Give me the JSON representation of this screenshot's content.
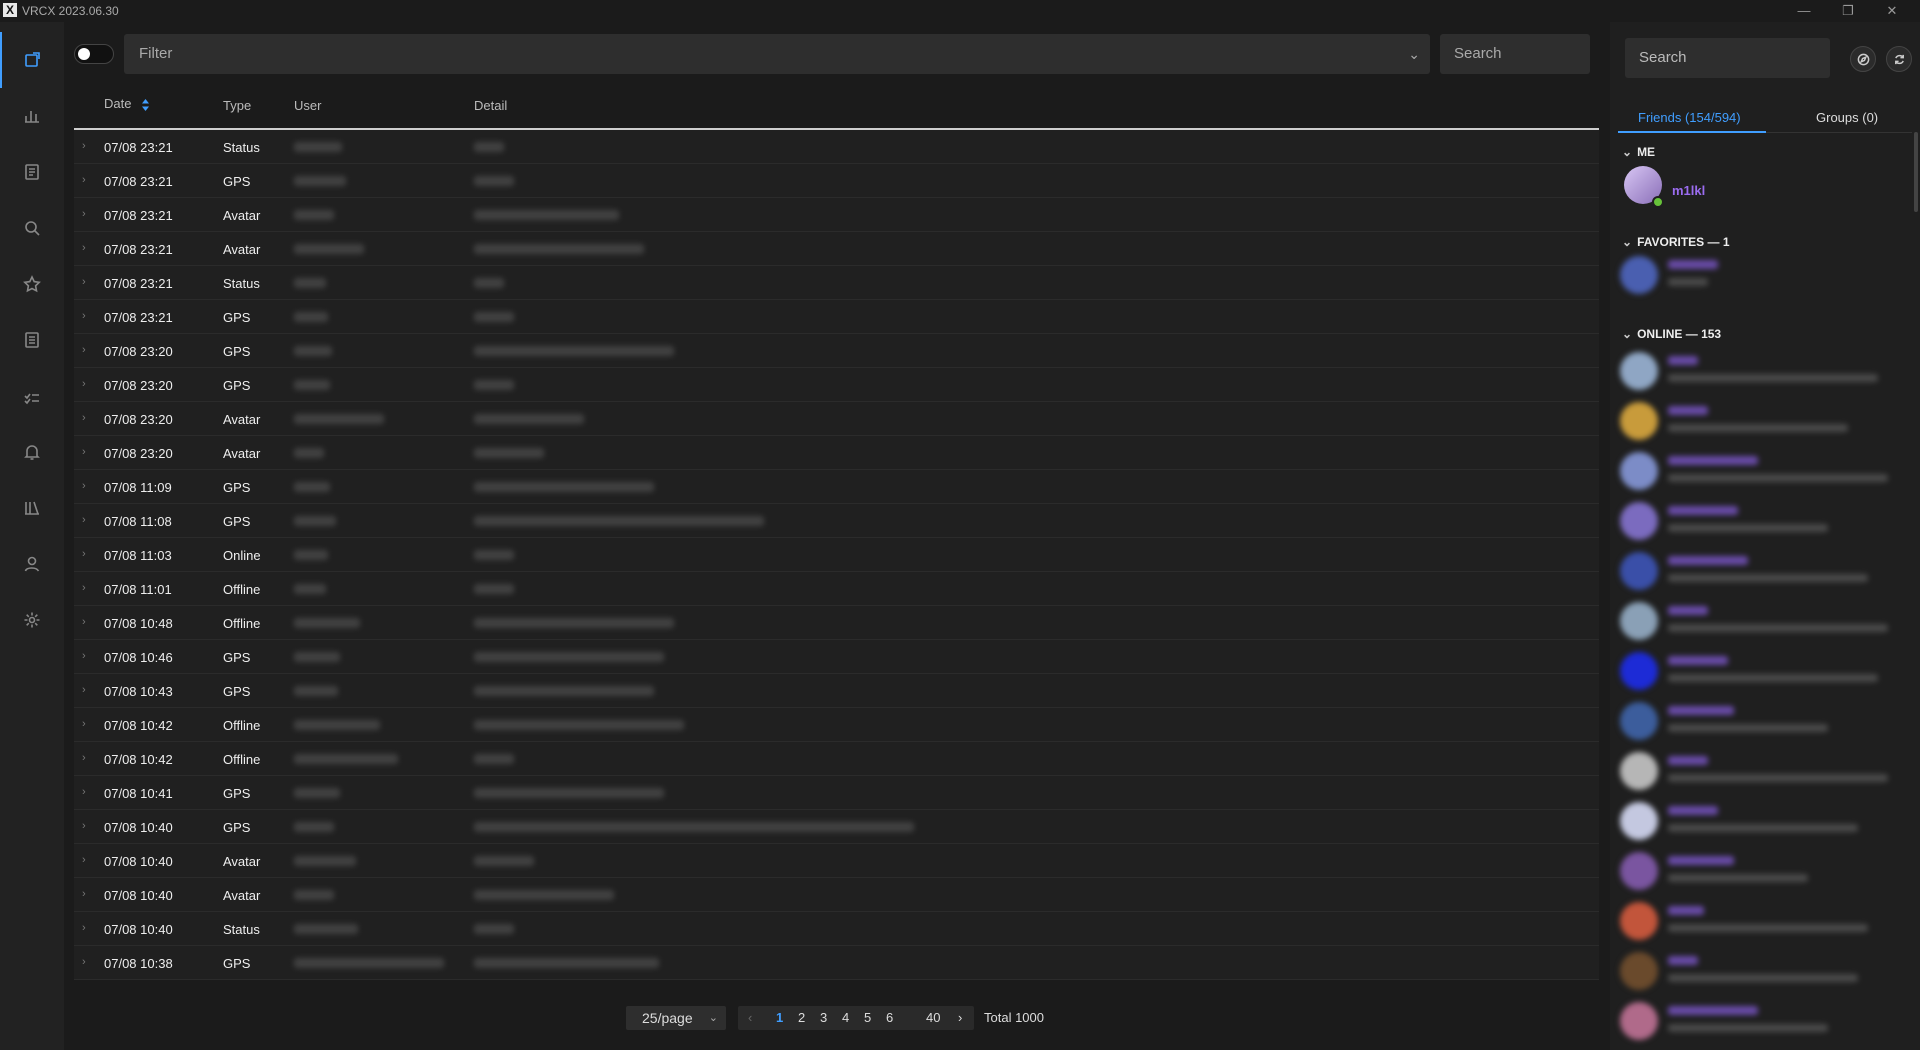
{
  "window": {
    "title": "VRCX 2023.06.30",
    "icon": "X"
  },
  "sidebar": {
    "items": [
      {
        "name": "feed",
        "icon": "feed-icon",
        "active": true
      },
      {
        "name": "charts",
        "icon": "bar-chart-icon"
      },
      {
        "name": "game-log",
        "icon": "document-icon"
      },
      {
        "name": "search",
        "icon": "search-icon"
      },
      {
        "name": "favorites",
        "icon": "star-icon"
      },
      {
        "name": "friend-log",
        "icon": "list-icon"
      },
      {
        "name": "moderation",
        "icon": "checklist-icon"
      },
      {
        "name": "notifications",
        "icon": "bell-icon"
      },
      {
        "name": "friends-list",
        "icon": "library-icon"
      },
      {
        "name": "profile",
        "icon": "user-icon"
      },
      {
        "name": "settings",
        "icon": "gear-icon"
      }
    ]
  },
  "toolbar": {
    "filter_placeholder": "Filter",
    "search_label": "Search"
  },
  "table": {
    "headers": {
      "date": "Date",
      "type": "Type",
      "user": "User",
      "detail": "Detail"
    },
    "rows": [
      {
        "date": "07/08 23:21",
        "type": "Status"
      },
      {
        "date": "07/08 23:21",
        "type": "GPS"
      },
      {
        "date": "07/08 23:21",
        "type": "Avatar"
      },
      {
        "date": "07/08 23:21",
        "type": "Avatar"
      },
      {
        "date": "07/08 23:21",
        "type": "Status"
      },
      {
        "date": "07/08 23:21",
        "type": "GPS"
      },
      {
        "date": "07/08 23:20",
        "type": "GPS"
      },
      {
        "date": "07/08 23:20",
        "type": "GPS"
      },
      {
        "date": "07/08 23:20",
        "type": "Avatar"
      },
      {
        "date": "07/08 23:20",
        "type": "Avatar"
      },
      {
        "date": "07/08 11:09",
        "type": "GPS"
      },
      {
        "date": "07/08 11:08",
        "type": "GPS"
      },
      {
        "date": "07/08 11:03",
        "type": "Online"
      },
      {
        "date": "07/08 11:01",
        "type": "Offline"
      },
      {
        "date": "07/08 10:48",
        "type": "Offline"
      },
      {
        "date": "07/08 10:46",
        "type": "GPS"
      },
      {
        "date": "07/08 10:43",
        "type": "GPS"
      },
      {
        "date": "07/08 10:42",
        "type": "Offline"
      },
      {
        "date": "07/08 10:42",
        "type": "Offline"
      },
      {
        "date": "07/08 10:41",
        "type": "GPS"
      },
      {
        "date": "07/08 10:40",
        "type": "GPS"
      },
      {
        "date": "07/08 10:40",
        "type": "Avatar"
      },
      {
        "date": "07/08 10:40",
        "type": "Avatar"
      },
      {
        "date": "07/08 10:40",
        "type": "Status"
      },
      {
        "date": "07/08 10:38",
        "type": "GPS"
      }
    ]
  },
  "pagination": {
    "per_page": "25/page",
    "pages": [
      "1",
      "2",
      "3",
      "4",
      "5",
      "6",
      "40"
    ],
    "current": "1",
    "total": "Total 1000"
  },
  "right_panel": {
    "search_placeholder": "Search",
    "tabs": {
      "friends": "Friends (154/594)",
      "groups": "Groups (0)"
    },
    "sections": {
      "me": "ME",
      "favorites": "FAVORITES — 1",
      "online": "ONLINE — 153"
    },
    "me": {
      "name": "m1lkl"
    }
  },
  "colors": {
    "accent": "#409eff",
    "me_name": "#9b6cf0",
    "online": "#67c23a"
  }
}
